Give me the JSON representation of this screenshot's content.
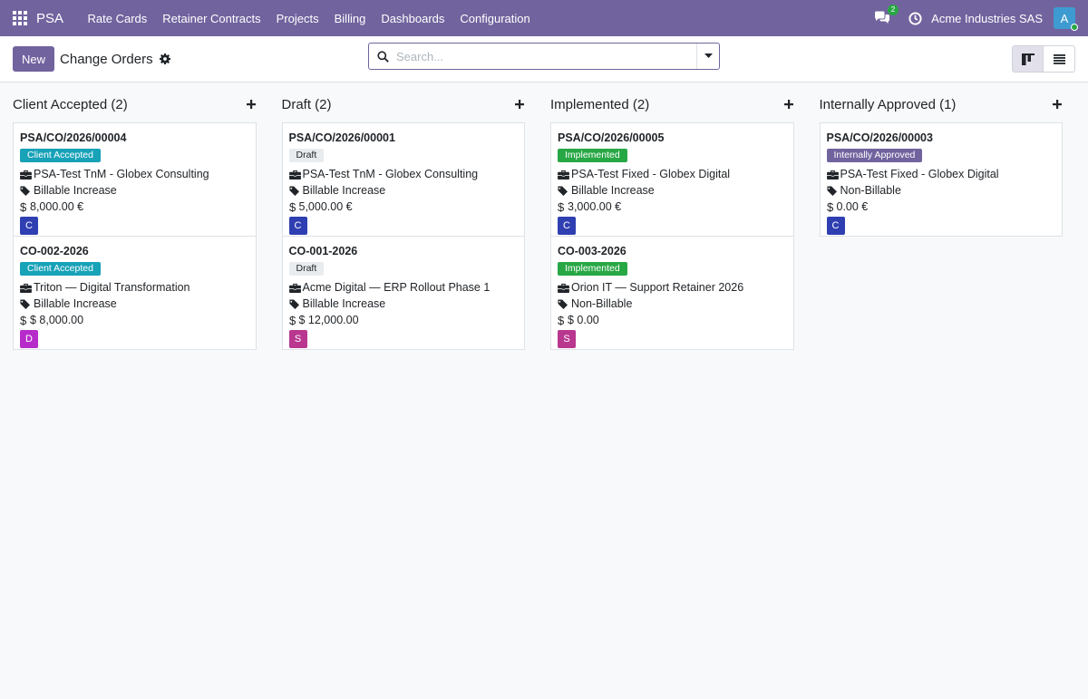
{
  "navbar": {
    "brand": "PSA",
    "menu": [
      "Rate Cards",
      "Retainer Contracts",
      "Projects",
      "Billing",
      "Dashboards",
      "Configuration"
    ],
    "chat_count": "2",
    "company": "Acme Industries SAS",
    "avatar_initial": "A"
  },
  "control": {
    "new_label": "New",
    "title": "Change Orders",
    "search_placeholder": "Search..."
  },
  "columns": [
    {
      "title": "Client Accepted (2)",
      "cards": [
        {
          "ref": "PSA/CO/2026/00004",
          "status": "Client Accepted",
          "project": "PSA-Test TnM - Globex Consulting",
          "billing": "Billable Increase",
          "amount": "8,000.00 €",
          "initial": "C"
        },
        {
          "ref": "CO-002-2026",
          "status": "Client Accepted",
          "project": "Triton — Digital Transformation",
          "billing": "Billable Increase",
          "amount": "$ 8,000.00",
          "initial": "D"
        }
      ]
    },
    {
      "title": "Draft (2)",
      "cards": [
        {
          "ref": "PSA/CO/2026/00001",
          "status": "Draft",
          "project": "PSA-Test TnM - Globex Consulting",
          "billing": "Billable Increase",
          "amount": "5,000.00 €",
          "initial": "C"
        },
        {
          "ref": "CO-001-2026",
          "status": "Draft",
          "project": "Acme Digital — ERP Rollout Phase 1",
          "billing": "Billable Increase",
          "amount": "$ 12,000.00",
          "initial": "S"
        }
      ]
    },
    {
      "title": "Implemented (2)",
      "cards": [
        {
          "ref": "PSA/CO/2026/00005",
          "status": "Implemented",
          "project": "PSA-Test Fixed - Globex Digital",
          "billing": "Billable Increase",
          "amount": "3,000.00 €",
          "initial": "C"
        },
        {
          "ref": "CO-003-2026",
          "status": "Implemented",
          "project": "Orion IT — Support Retainer 2026",
          "billing": "Non-Billable",
          "amount": "$ 0.00",
          "initial": "S"
        }
      ]
    },
    {
      "title": "Internally Approved (1)",
      "cards": [
        {
          "ref": "PSA/CO/2026/00003",
          "status": "Internally Approved",
          "project": "PSA-Test Fixed - Globex Digital",
          "billing": "Non-Billable",
          "amount": "0.00 €",
          "initial": "C"
        }
      ]
    }
  ],
  "colors": {
    "navbar": "#71639e",
    "status_client_accepted": "#17a2b8",
    "status_draft": "#e9ecef",
    "status_implemented": "#28a745",
    "status_internally_approved": "#71639e",
    "initial_c": "#2f3fb2",
    "initial_d": "#b62bc9",
    "initial_s": "#b9378f"
  }
}
